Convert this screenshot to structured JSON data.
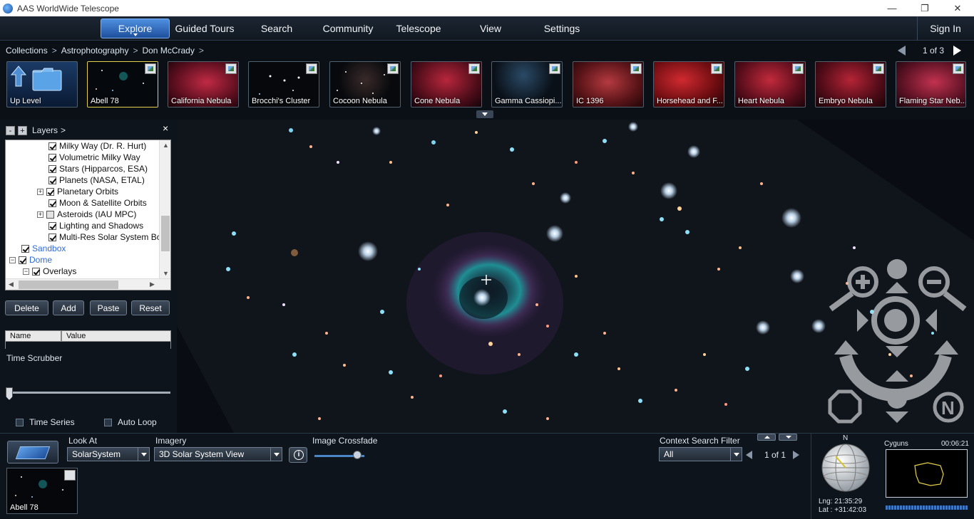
{
  "window": {
    "title": "AAS WorldWide Telescope",
    "controls": [
      "—",
      "❐",
      "✕"
    ]
  },
  "menu": {
    "items": [
      "Explore",
      "Guided Tours",
      "Search",
      "Community",
      "Telescope",
      "View",
      "Settings"
    ],
    "sign_in": "Sign In"
  },
  "breadcrumb": {
    "items": [
      "Collections",
      "Astrophotography",
      "Don McCrady"
    ],
    "separator": ">"
  },
  "collection_pager": {
    "text": "1 of 3"
  },
  "thumbnails": [
    {
      "label": "Up Level",
      "kind": "folder"
    },
    {
      "label": "Abell 78",
      "kind": "image",
      "selected": true
    },
    {
      "label": "California Nebula",
      "kind": "image"
    },
    {
      "label": "Brocchi's Cluster",
      "kind": "image"
    },
    {
      "label": "Cocoon Nebula",
      "kind": "image"
    },
    {
      "label": "Cone Nebula",
      "kind": "image"
    },
    {
      "label": "Gamma Cassiopi...",
      "kind": "image"
    },
    {
      "label": "IC 1396",
      "kind": "image"
    },
    {
      "label": "Horsehead and F...",
      "kind": "image"
    },
    {
      "label": "Heart Nebula",
      "kind": "image"
    },
    {
      "label": "Embryo Nebula",
      "kind": "image"
    },
    {
      "label": "Flaming Star Neb...",
      "kind": "image"
    }
  ],
  "layers": {
    "title": "Layers",
    "title_chevron": ">",
    "collapse_label": "-",
    "expand_label": "+",
    "close_label": "×",
    "tree": [
      {
        "label": "Milky Way (Dr. R. Hurt)",
        "checked": true,
        "level": 2,
        "expander": ""
      },
      {
        "label": "Volumetric Milky Way",
        "checked": true,
        "level": 2,
        "expander": ""
      },
      {
        "label": "Stars (Hipparcos, ESA)",
        "checked": true,
        "level": 2,
        "expander": ""
      },
      {
        "label": "Planets (NASA, ETAL)",
        "checked": true,
        "level": 2,
        "expander": ""
      },
      {
        "label": "Planetary Orbits",
        "checked": true,
        "level": 2,
        "expander": "+"
      },
      {
        "label": "Moon & Satellite Orbits",
        "checked": true,
        "level": 2,
        "expander": ""
      },
      {
        "label": "Asteroids (IAU MPC)",
        "checked": false,
        "level": 2,
        "expander": "+"
      },
      {
        "label": "Lighting and Shadows",
        "checked": true,
        "level": 2,
        "expander": ""
      },
      {
        "label": "Multi-Res Solar System Bodies",
        "checked": true,
        "level": 2,
        "expander": ""
      },
      {
        "label": "Sandbox",
        "checked": true,
        "level": 0,
        "expander": "",
        "link": true
      },
      {
        "label": "Dome",
        "checked": true,
        "level": 0,
        "expander": "−",
        "link": true
      },
      {
        "label": "Overlays",
        "checked": true,
        "level": 1,
        "expander": "−"
      }
    ],
    "buttons": [
      "Delete",
      "Add",
      "Paste",
      "Reset"
    ],
    "grid_headers": [
      "Name",
      "Value"
    ],
    "time_scrubber_label": "Time Scrubber",
    "time_series_label": "Time Series",
    "auto_loop_label": "Auto Loop"
  },
  "bottom": {
    "look_at_label": "Look At",
    "look_at_value": "SolarSystem",
    "imagery_label": "Imagery",
    "imagery_value": "3D Solar System View",
    "crossfade_label": "Image Crossfade",
    "crossfade_level": 0.85,
    "context_filter_label": "Context Search Filter",
    "context_filter_value": "All",
    "context_pager": "1 of 1",
    "current_thumb_label": "Abell 78",
    "compass_north": "N",
    "constellation": "Cyguns",
    "time_readout": "00:06:21",
    "lng_label": "Lng:",
    "lng_value": "21:35:29",
    "lat_label": "Lat :",
    "lat_value": "+31:42:03"
  },
  "colors": {
    "accent": "#2f6fc4",
    "selected_border": "#e6d04a",
    "nebula_teal": "#1fa3a6",
    "link_blue": "#2e6bd6"
  }
}
